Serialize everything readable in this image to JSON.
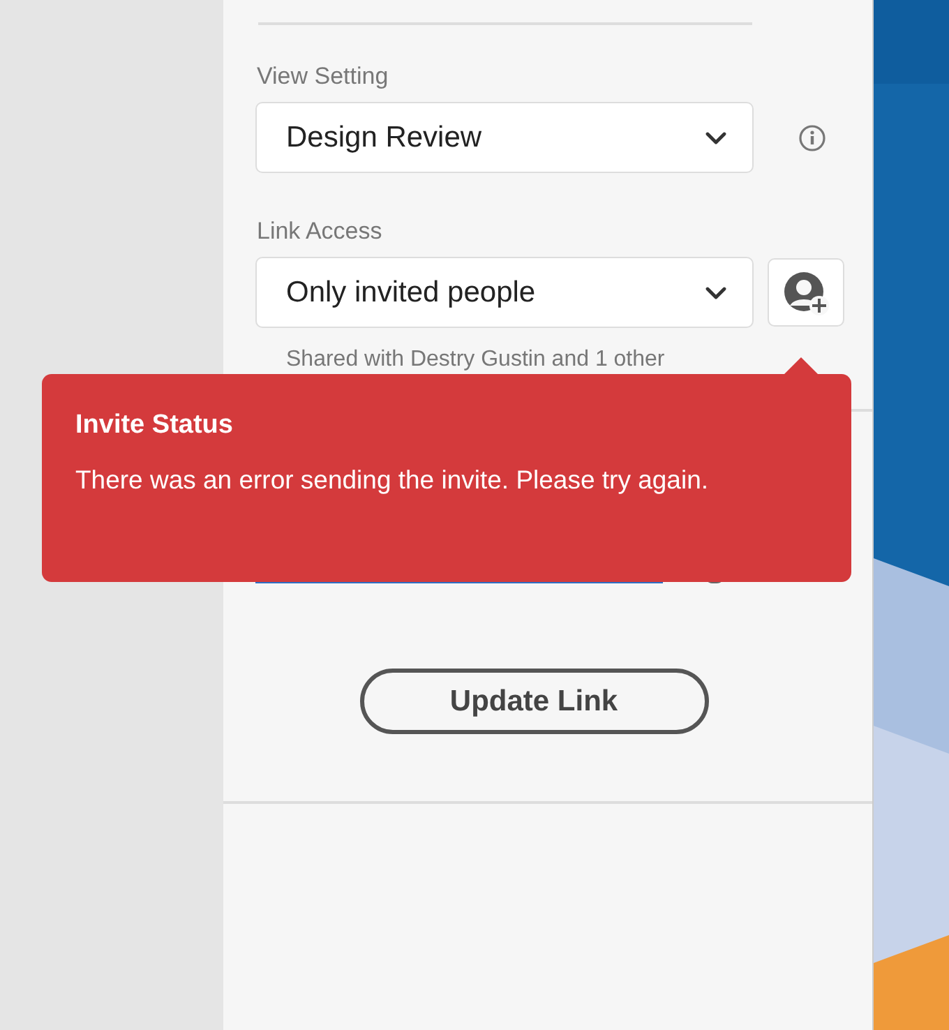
{
  "view_setting": {
    "label": "View Setting",
    "value": "Design Review"
  },
  "link_access": {
    "label": "Link Access",
    "value": "Only invited people",
    "shared_note": "Shared with Destry Gustin and 1 other"
  },
  "update_button": "Update Link",
  "toast": {
    "kind": "error",
    "title": "Invite Status",
    "message": "There was an error sending the invite. Please try again."
  }
}
